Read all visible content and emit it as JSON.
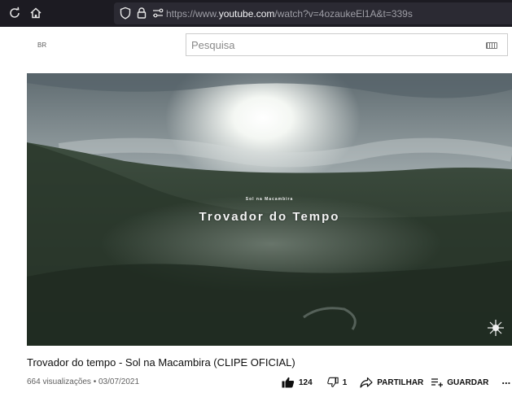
{
  "browser": {
    "url_prefix": "https://www.",
    "url_domain": "youtube.com",
    "url_path": "/watch?v=4ozaukeEl1A&t=339s",
    "icons": [
      "reload-icon",
      "home-icon",
      "shield-icon",
      "lock-icon",
      "permissions-icon"
    ]
  },
  "youtube": {
    "region": "BR",
    "search_placeholder": "Pesquisa"
  },
  "video": {
    "overlay_subtitle": "Sol na Macambira",
    "overlay_title": "Trovador do Tempo",
    "title": "Trovador do tempo - Sol na Macambira (CLIPE OFICIAL)",
    "meta": "664 visualizações • 03/07/2021",
    "likes": "124",
    "dislikes": "1",
    "share_label": "PARTILHAR",
    "save_label": "GUARDAR",
    "more_label": "..."
  },
  "colors": {
    "browser_bar": "#1c1b22",
    "url_field": "#2b2a33",
    "text_primary": "#0f0f0f",
    "text_secondary": "#606060"
  }
}
